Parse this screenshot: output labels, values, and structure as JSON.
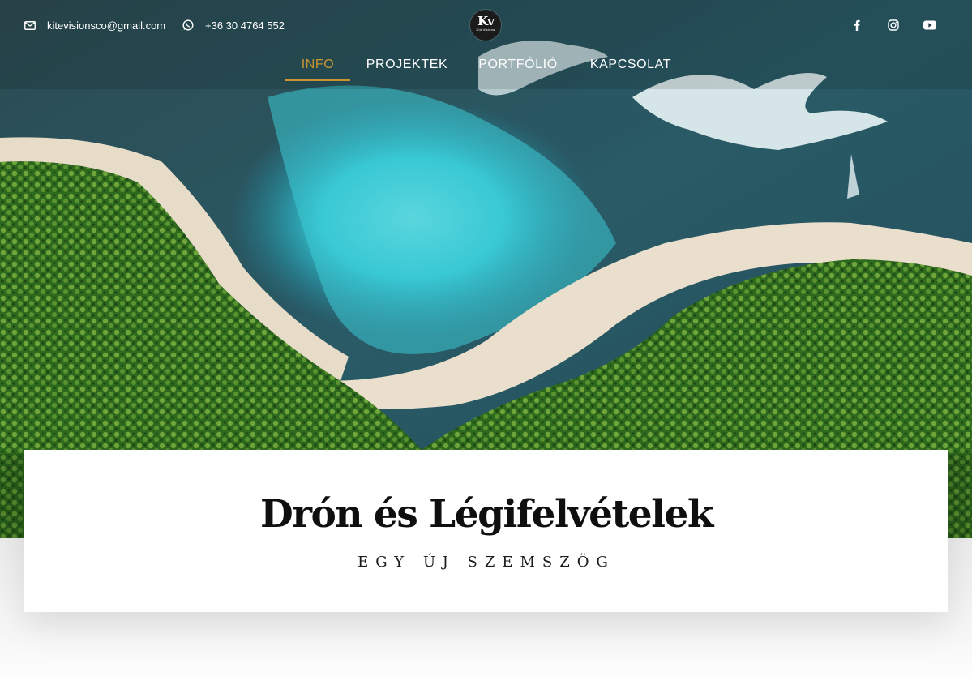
{
  "header": {
    "email": "kitevisionsco@gmail.com",
    "phone": "+36 30 4764 552",
    "logo": {
      "monogram": "Kv",
      "wordmark": "KiteVisions"
    },
    "social": [
      {
        "icon": "facebook-icon"
      },
      {
        "icon": "instagram-icon"
      },
      {
        "icon": "youtube-icon"
      }
    ]
  },
  "nav": {
    "items": [
      {
        "label": "INFO",
        "active": true
      },
      {
        "label": "PROJEKTEK",
        "active": false
      },
      {
        "label": "PORTFÓLIÓ",
        "active": false
      },
      {
        "label": "KAPCSOLAT",
        "active": false
      }
    ]
  },
  "hero_card": {
    "title": "Drón és Légifelvételek",
    "subtitle": "EGY ÚJ SZEMSZÖG"
  },
  "colors": {
    "accent": "#c9952f",
    "text": "#ffffff",
    "title": "#0f0f0f"
  }
}
